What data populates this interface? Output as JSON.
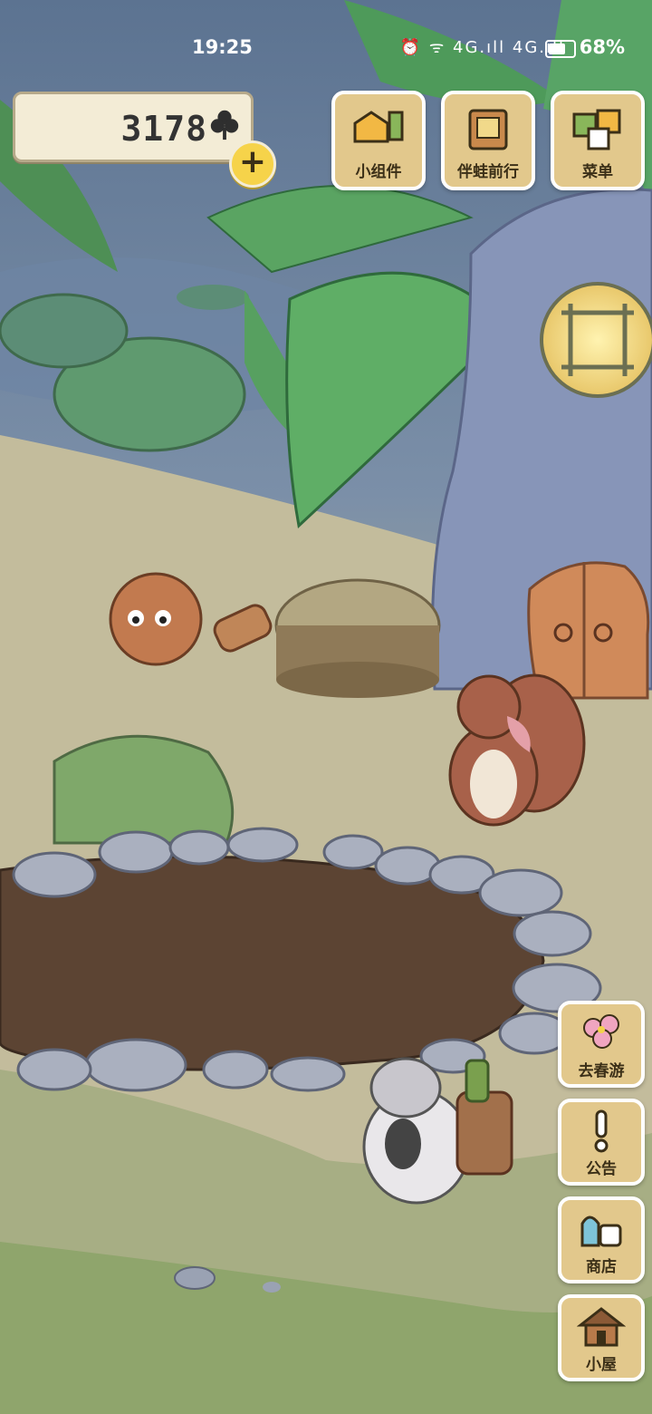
{
  "status_bar": {
    "time": "19:25",
    "network_icons": "⏰ ᯤ 4G.ıll 4G.ıll",
    "battery_percent": "68%"
  },
  "currency": {
    "clover_count": "3178",
    "clover_icon": "clover-icon",
    "add_label": "+"
  },
  "top_menu": {
    "widgets_label": "小组件",
    "travel_label": "伴蛙前行",
    "menu_label": "菜单"
  },
  "side_menu": {
    "spring_trip_label": "去春游",
    "notice_label": "公告",
    "shop_label": "商店",
    "house_label": "小屋"
  },
  "colors": {
    "button_wood": "#e2c88c",
    "button_border": "#ffffff",
    "soil": "#5c4433",
    "grass": "#7fa85a",
    "tree_trunk": "#8795b8"
  }
}
